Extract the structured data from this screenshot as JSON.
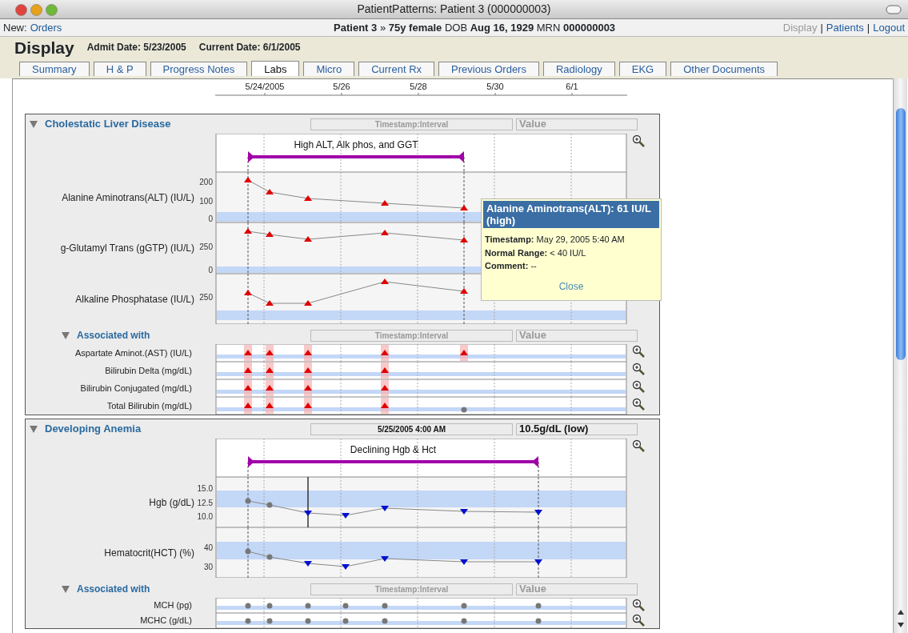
{
  "window": {
    "title": "PatientPatterns: Patient 3 (000000003)"
  },
  "toolbar": {
    "new_label": "New:",
    "new_link": "Orders",
    "patient": "**Patient 3** » **75y female** DOB **Aug 16, 1929** MRN **000000003**",
    "separator": "|",
    "links": [
      {
        "label": "Display",
        "selected": true
      },
      {
        "label": "Patients",
        "selected": false
      },
      {
        "label": "Logout",
        "selected": false
      }
    ]
  },
  "header": {
    "title": "Display",
    "admit": "Admit Date: 5/23/2005",
    "current": "Current Date: 6/1/2005"
  },
  "tabs": [
    {
      "label": "Summary",
      "selected": false
    },
    {
      "label": "H & P",
      "selected": false
    },
    {
      "label": "Progress Notes",
      "selected": false
    },
    {
      "label": "Labs",
      "selected": true
    },
    {
      "label": "Micro",
      "selected": false
    },
    {
      "label": "Current Rx",
      "selected": false
    },
    {
      "label": "Previous Orders",
      "selected": false
    },
    {
      "label": "Radiology",
      "selected": false
    },
    {
      "label": "EKG",
      "selected": false
    },
    {
      "label": "Other Documents",
      "selected": false
    }
  ],
  "timeline": {
    "labels": [
      "5/24/2005",
      "5/26",
      "5/28",
      "5/30",
      "6/1"
    ]
  },
  "panels": [
    {
      "title": "Cholestatic Liver Disease",
      "expanded": true,
      "timestamp": {
        "placeholder": "Timestamp:Interval"
      },
      "value": {
        "placeholder": "Value"
      },
      "annotation": "High ALT, Alk phos, and GGT",
      "rows": [
        {
          "label": "Alanine Aminotrans(ALT) (IU/L)",
          "ticks": [
            "200",
            "100",
            "0"
          ],
          "points": [
            {
              "kind": "high"
            },
            {
              "kind": "high"
            },
            {
              "kind": "high"
            },
            {
              "kind": "high"
            },
            {
              "kind": "high"
            }
          ]
        },
        {
          "label": "g-Glutamyl Trans (gGTP) (IU/L)",
          "ticks": [
            "250",
            "0"
          ],
          "points": [
            {
              "kind": "high"
            },
            {
              "kind": "high"
            },
            {
              "kind": "high"
            },
            {
              "kind": "high"
            },
            {
              "kind": "high"
            }
          ]
        },
        {
          "label": "Alkaline Phosphatase (IU/L)",
          "ticks": [
            "250"
          ],
          "points": [
            {
              "kind": "high"
            },
            {
              "kind": "high"
            },
            {
              "kind": "high"
            },
            {
              "kind": "high"
            },
            {
              "kind": "high"
            }
          ]
        }
      ],
      "associated": {
        "title": "Associated with",
        "expanded": true,
        "timestamp": {
          "placeholder": "Timestamp:Interval"
        },
        "value": {
          "placeholder": "Value"
        },
        "rows": [
          {
            "label": "Aspartate Aminot.(AST) (IU/L)",
            "points": [
              {
                "kind": "high"
              },
              {
                "kind": "high"
              },
              {
                "kind": "high"
              },
              {
                "kind": "high"
              },
              {
                "kind": "high"
              }
            ]
          },
          {
            "label": "Bilirubin Delta (mg/dL)",
            "points": [
              {
                "kind": "high"
              },
              {
                "kind": "high"
              },
              {
                "kind": "high"
              },
              {
                "kind": "high"
              }
            ]
          },
          {
            "label": "Bilirubin Conjugated (mg/dL)",
            "points": [
              {
                "kind": "high"
              },
              {
                "kind": "high"
              },
              {
                "kind": "high"
              },
              {
                "kind": "high"
              }
            ]
          },
          {
            "label": "Total Bilirubin (mg/dL)",
            "points": [
              {
                "kind": "high"
              },
              {
                "kind": "high"
              },
              {
                "kind": "high"
              },
              {
                "kind": "high"
              },
              {
                "kind": "normal"
              }
            ]
          }
        ]
      },
      "tooltip": {
        "title": "Alanine Aminotrans(ALT): 61 IU/L (high)",
        "lines": [
          "**Timestamp:** May 29, 2005 5:40 AM",
          "**Normal Range:** < 40 IU/L",
          "**Comment:** --"
        ],
        "close": "Close"
      }
    },
    {
      "title": "Developing Anemia",
      "expanded": true,
      "timestamp": {
        "value": "5/25/2005 4:00 AM"
      },
      "value": {
        "value": "10.5g/dL (low)"
      },
      "annotation": "Declining Hgb & Hct",
      "rows": [
        {
          "label": "Hgb (g/dL)",
          "ticks": [
            "15.0",
            "12.5",
            "10.0"
          ],
          "points": [
            {
              "kind": "normal"
            },
            {
              "kind": "normal"
            },
            {
              "kind": "low"
            },
            {
              "kind": "low"
            },
            {
              "kind": "low"
            },
            {
              "kind": "low"
            },
            {
              "kind": "low"
            }
          ]
        },
        {
          "label": "Hematocrit(HCT) (%)",
          "ticks": [
            "40",
            "30"
          ],
          "points": [
            {
              "kind": "normal"
            },
            {
              "kind": "normal"
            },
            {
              "kind": "low"
            },
            {
              "kind": "low"
            },
            {
              "kind": "low"
            },
            {
              "kind": "low"
            },
            {
              "kind": "low"
            }
          ]
        }
      ],
      "associated": {
        "title": "Associated with",
        "expanded": true,
        "timestamp": {
          "placeholder": "Timestamp:Interval"
        },
        "value": {
          "placeholder": "Value"
        },
        "rows": [
          {
            "label": "MCH (pg)",
            "points": [
              {
                "kind": "normal"
              },
              {
                "kind": "normal"
              },
              {
                "kind": "normal"
              },
              {
                "kind": "normal"
              },
              {
                "kind": "normal"
              },
              {
                "kind": "normal"
              },
              {
                "kind": "normal"
              }
            ]
          },
          {
            "label": "MCHC (g/dL)",
            "points": [
              {
                "kind": "normal"
              },
              {
                "kind": "normal"
              },
              {
                "kind": "normal"
              },
              {
                "kind": "normal"
              },
              {
                "kind": "normal"
              },
              {
                "kind": "normal"
              },
              {
                "kind": "normal"
              }
            ]
          }
        ]
      }
    }
  ]
}
